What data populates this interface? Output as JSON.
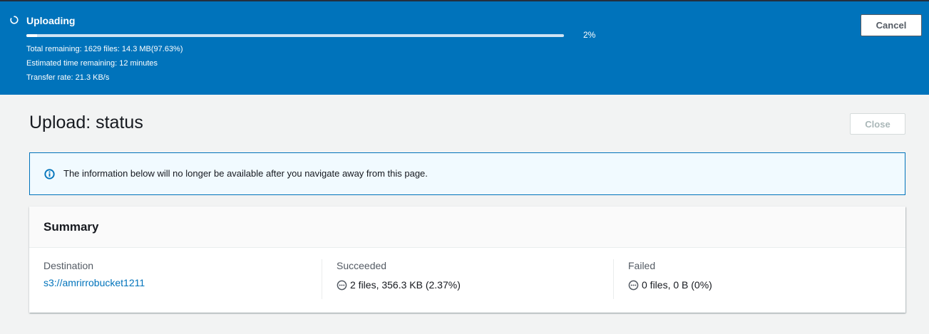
{
  "banner": {
    "title": "Uploading",
    "progress_percent": 2,
    "progress_label": "2%",
    "total_remaining": "Total remaining: 1629 files: 14.3 MB(97.63%)",
    "time_remaining": "Estimated time remaining: 12 minutes",
    "transfer_rate": "Transfer rate: 21.3 KB/s",
    "cancel_label": "Cancel",
    "background_color": "#0073bb"
  },
  "page": {
    "title": "Upload: status",
    "close_label": "Close"
  },
  "alert": {
    "icon": "info-icon",
    "message": "The information below will no longer be available after you navigate away from this page."
  },
  "summary": {
    "heading": "Summary",
    "destination": {
      "label": "Destination",
      "value": "s3://amrirrobucket1211"
    },
    "succeeded": {
      "label": "Succeeded",
      "icon": "pending-status-icon",
      "value": "2 files, 356.3 KB (2.37%)"
    },
    "failed": {
      "label": "Failed",
      "icon": "pending-status-icon",
      "value": "0 files, 0 B (0%)"
    }
  },
  "colors": {
    "accent": "#0073bb",
    "link": "#0073bb",
    "text": "#16191f",
    "muted": "#545b64"
  }
}
